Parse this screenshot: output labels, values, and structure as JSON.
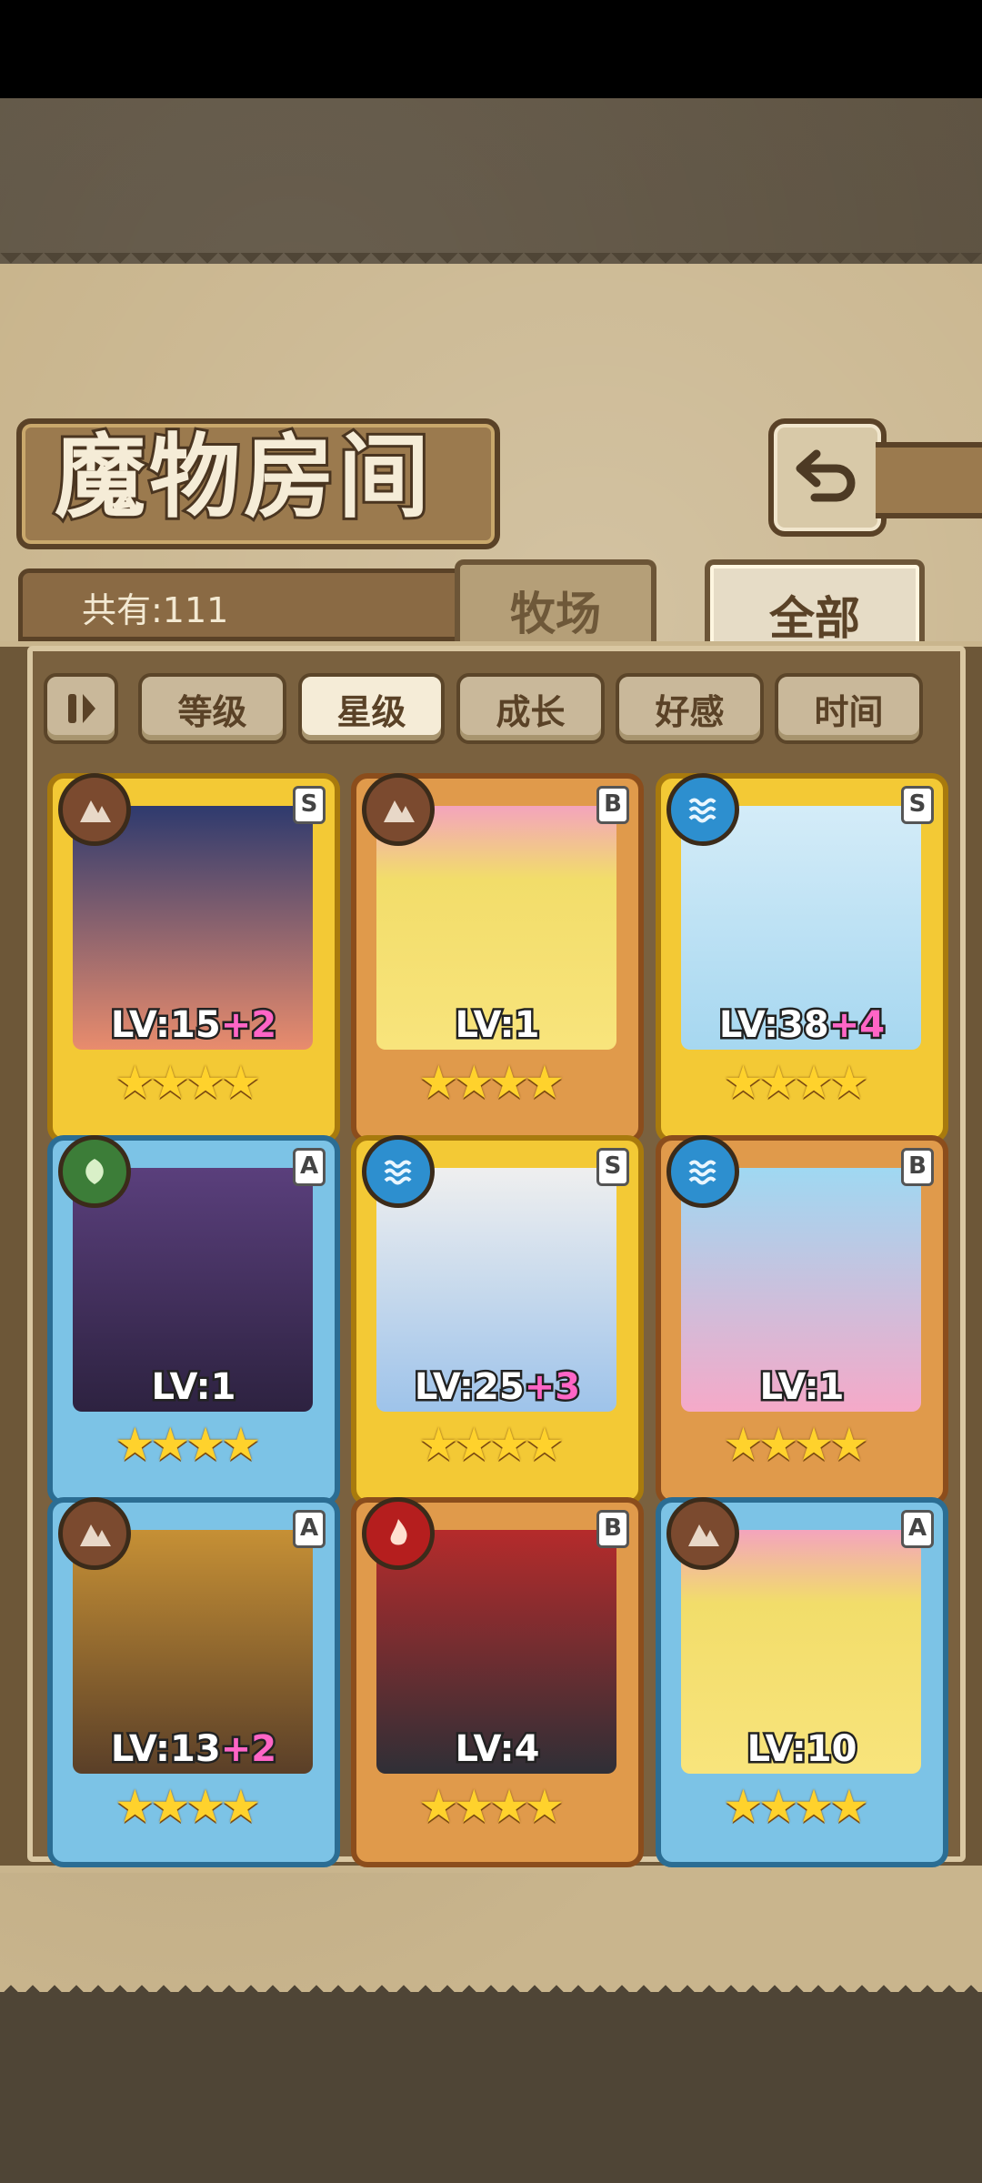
{
  "header": {
    "title": "魔物房间",
    "back_icon": "back-arrow-icon"
  },
  "summary": {
    "count_label": "共有:111"
  },
  "tabs": [
    {
      "label": "牧场",
      "active": false
    },
    {
      "label": "全部",
      "active": true
    }
  ],
  "filters": {
    "sort_toggle_icon": "pause-sort-icon",
    "items": [
      {
        "label": "等级",
        "active": false
      },
      {
        "label": "星级",
        "active": true
      },
      {
        "label": "成长",
        "active": false
      },
      {
        "label": "好感",
        "active": false
      },
      {
        "label": "时间",
        "active": false
      }
    ]
  },
  "monsters": [
    {
      "rank": "S",
      "element": "earth",
      "stars": 4,
      "level": "LV:15",
      "bonus": "+2"
    },
    {
      "rank": "B",
      "element": "earth",
      "stars": 4,
      "level": "LV:1",
      "bonus": ""
    },
    {
      "rank": "S",
      "element": "water",
      "stars": 4,
      "level": "LV:38",
      "bonus": "+4"
    },
    {
      "rank": "A",
      "element": "leaf",
      "stars": 4,
      "level": "LV:1",
      "bonus": ""
    },
    {
      "rank": "S",
      "element": "water",
      "stars": 4,
      "level": "LV:25",
      "bonus": "+3"
    },
    {
      "rank": "B",
      "element": "water",
      "stars": 4,
      "level": "LV:1",
      "bonus": ""
    },
    {
      "rank": "A",
      "element": "earth",
      "stars": 4,
      "level": "LV:13",
      "bonus": "+2"
    },
    {
      "rank": "B",
      "element": "fire",
      "stars": 4,
      "level": "LV:4",
      "bonus": ""
    },
    {
      "rank": "A",
      "element": "earth",
      "stars": 4,
      "level": "LV:10",
      "bonus": ""
    }
  ],
  "colors": {
    "panel": "#c9b58d",
    "frame_dark": "#5a4227",
    "s_frame": "#f3c935",
    "a_frame": "#7cc3e6",
    "b_frame": "#e09a4b",
    "plus_text": "#ff65c6"
  }
}
